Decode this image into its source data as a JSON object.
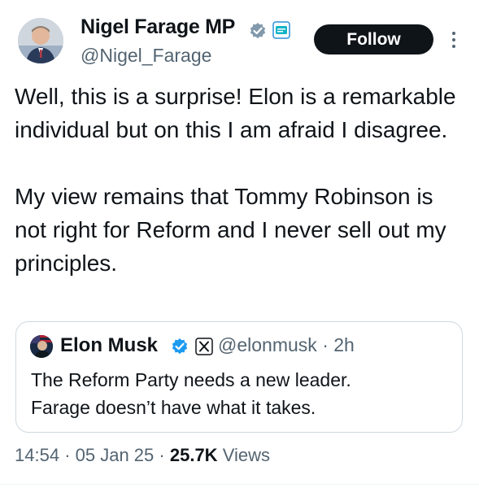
{
  "author": {
    "name": "Nigel Farage MP",
    "handle": "@Nigel_Farage",
    "verified_icon": "verified-badge-icon",
    "affiliation_icon": "affiliation-badge-icon"
  },
  "actions": {
    "follow_label": "Follow",
    "more_icon": "more-vertical-icon"
  },
  "tweet": {
    "paragraphs": [
      "Well, this is a surprise! Elon is a remarkable individual but on this I am afraid I disagree.",
      "My view remains that Tommy Robinson is not right for Reform and I never sell out my principles."
    ]
  },
  "quoted": {
    "name": "Elon Musk",
    "handle": "@elonmusk",
    "separator": "·",
    "time": "2h",
    "lines": [
      "The Reform Party needs a new leader.",
      "Farage doesn’t have what it takes."
    ]
  },
  "meta": {
    "time": "14:54",
    "sep1": "·",
    "date": "05 Jan 25",
    "sep2": "·",
    "views_count": "25.7K",
    "views_label": "Views"
  },
  "colors": {
    "verified": "#829aab",
    "text": "#0f1419",
    "secondary": "#536471",
    "border": "#cfd9de"
  }
}
